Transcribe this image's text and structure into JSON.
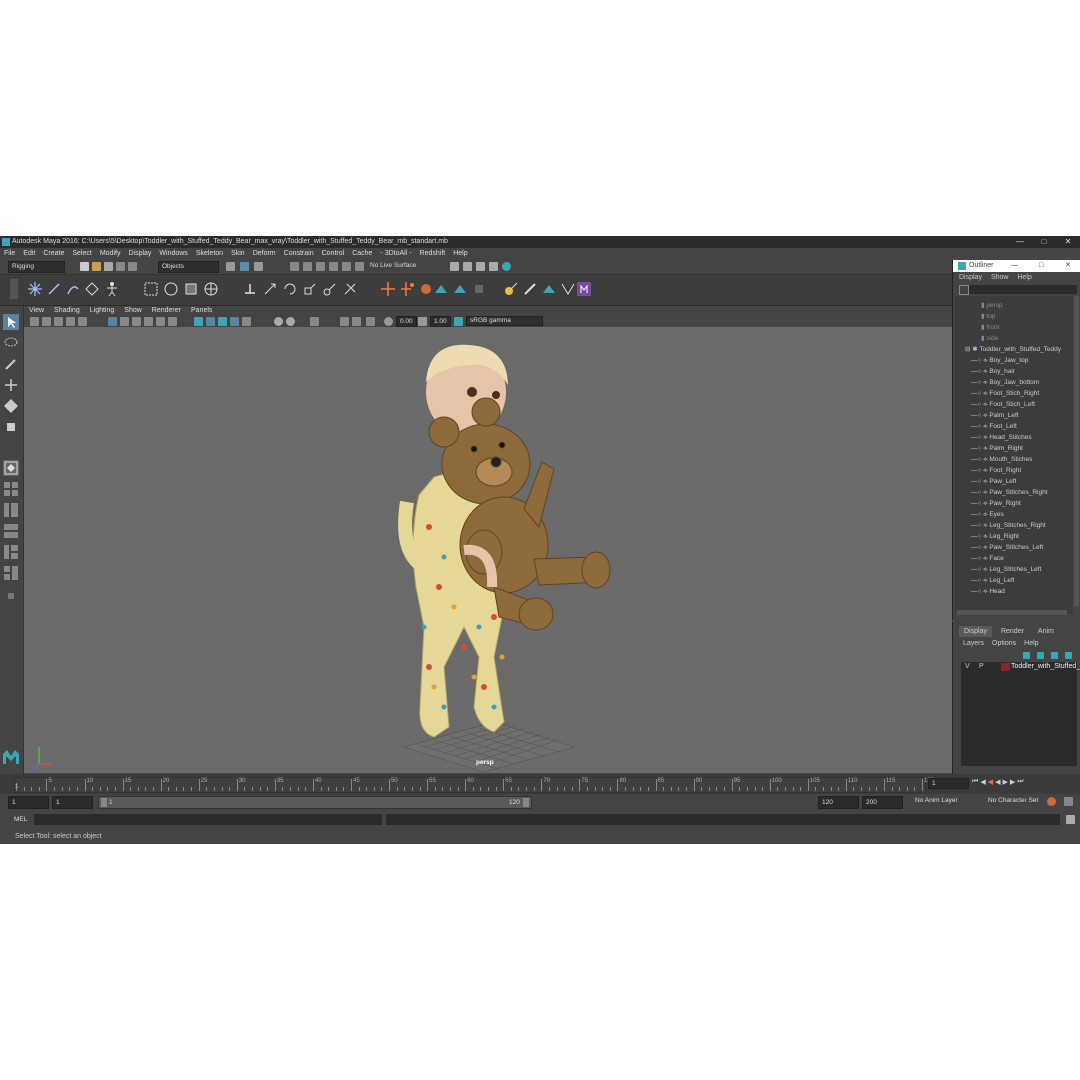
{
  "title": "Autodesk Maya 2016: C:\\Users\\5\\Desktop\\Toddler_with_Stuffed_Teddy_Bear_max_vray\\Toddler_with_Stuffed_Teddy_Bear_mb_standart.mb",
  "menus": [
    "File",
    "Edit",
    "Create",
    "Select",
    "Modify",
    "Display",
    "Windows",
    "Skeleton",
    "Skin",
    "Deform",
    "Constrain",
    "Control",
    "Cache",
    "- 3DtoAll -",
    "Redshift",
    "Help"
  ],
  "status": {
    "mode": "Rigging",
    "selection": "Objects",
    "live_surface": "No Live Surface"
  },
  "viewport": {
    "menus": [
      "View",
      "Shading",
      "Lighting",
      "Show",
      "Renderer",
      "Panels"
    ],
    "gamma_value": "0.00",
    "exposure_value": "1.00",
    "color_space": "sRGB gamma",
    "camera": "persp"
  },
  "outliner": {
    "window_title": "Outliner",
    "menus": [
      "Display",
      "Show",
      "Help"
    ],
    "cameras": [
      "persp",
      "top",
      "front",
      "side"
    ],
    "group": "Toddler_with_Stuffed_Teddy",
    "items": [
      "Boy_Jaw_top",
      "Boy_hair",
      "Boy_Jaw_bottom",
      "Foot_Stich_Right",
      "Foot_Stich_Left",
      "Palm_Left",
      "Foot_Left",
      "Head_Stitches",
      "Palm_Right",
      "Mouth_Stiches",
      "Foot_Right",
      "Paw_Left",
      "Paw_Stitches_Right",
      "Paw_Right",
      "Eyes",
      "Leg_Stitches_Right",
      "Leg_Right",
      "Paw_Stitches_Left",
      "Face",
      "Leg_Stitches_Left",
      "Leg_Left",
      "Head"
    ]
  },
  "layers": {
    "tabs": [
      "Display",
      "Render",
      "Anim"
    ],
    "menus": [
      "Layers",
      "Options",
      "Help"
    ],
    "v": "V",
    "p": "P",
    "layer_name": "Toddler_with_Stuffed_",
    "layer_color": "#9b1b30"
  },
  "timeline": {
    "ticks": [
      "5",
      "10",
      "15",
      "20",
      "25",
      "30",
      "35",
      "40",
      "45",
      "50",
      "55",
      "60",
      "65",
      "70",
      "75",
      "80",
      "85",
      "90",
      "95",
      "100",
      "105",
      "110",
      "115",
      "120"
    ],
    "start_marker": "1",
    "current_frame": "1"
  },
  "range": {
    "start": "1",
    "start2": "1",
    "slider_start": "1",
    "slider_end": "120",
    "end": "120",
    "end2": "200",
    "anim_layer": "No Anim Layer",
    "char_set": "No Character Set"
  },
  "command": {
    "lang": "MEL"
  },
  "help_text": "Select Tool: select an object",
  "colors": {
    "accent": "#3aa7b8",
    "viewport_bg": "#6a6a6a",
    "panel_bg": "#444444"
  }
}
